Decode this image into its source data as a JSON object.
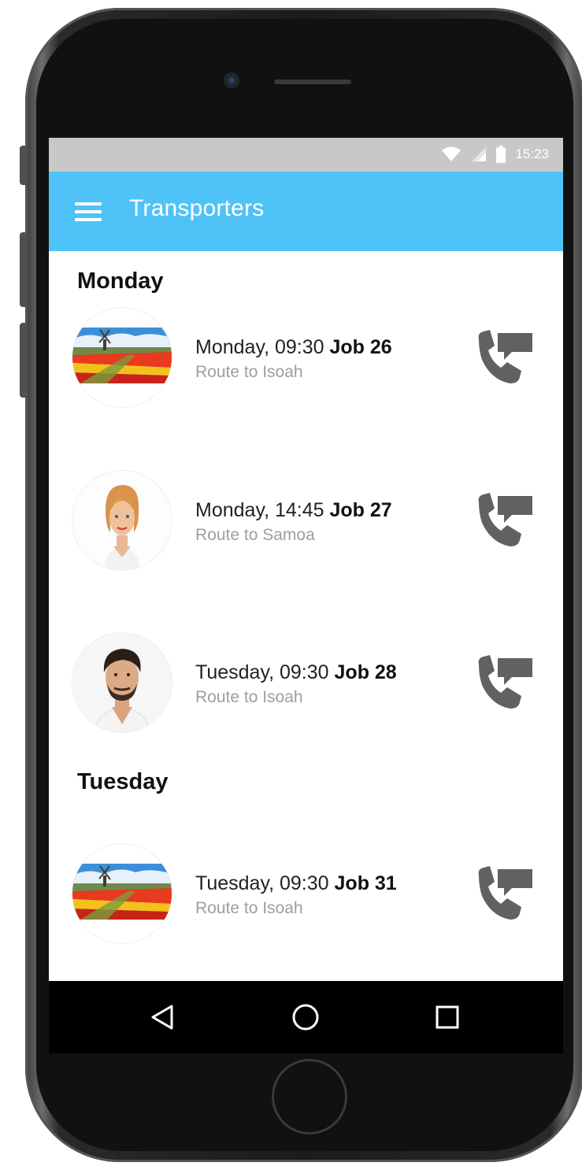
{
  "status_bar": {
    "time": "15:23",
    "icons": [
      "wifi-icon",
      "signal-icon",
      "battery-icon"
    ]
  },
  "app_bar": {
    "title": "Transporters",
    "menu_icon": "hamburger-menu-icon",
    "background_color": "#4fc3f7"
  },
  "sections": [
    {
      "header": "Monday",
      "items": [
        {
          "time": "Monday, 09:30",
          "job": "Job 26",
          "route": "Route to Isoah",
          "avatar": "tulip-field-windmill-photo"
        },
        {
          "time": "Monday, 14:45",
          "job": "Job 27",
          "route": "Route to Samoa",
          "avatar": "woman-portrait-photo"
        },
        {
          "time": "Tuesday, 09:30",
          "job": "Job 28",
          "route": "Route to Isoah",
          "avatar": "man-portrait-photo"
        }
      ]
    },
    {
      "header": "Tuesday",
      "items": [
        {
          "time": "Tuesday, 09:30",
          "job": "Job 31",
          "route": "Route to Isoah",
          "avatar": "tulip-field-windmill-photo"
        }
      ]
    }
  ],
  "item_action_icon": "phone-message-icon",
  "nav_bar": {
    "icons": [
      "back-triangle-icon",
      "home-circle-icon",
      "recents-square-icon"
    ]
  }
}
